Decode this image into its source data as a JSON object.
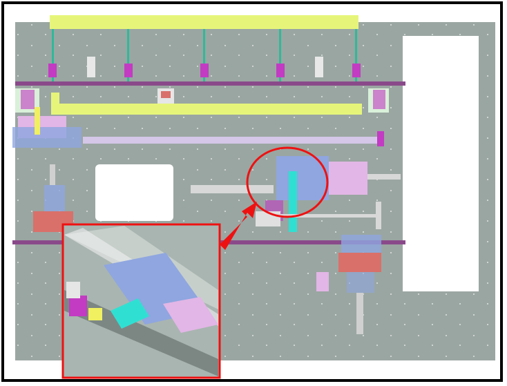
{
  "figure": {
    "colors": {
      "frame": "#000000",
      "plate": "#9aa6a2",
      "rail_yellow": "#e6f57a",
      "magenta": "#c23bc2",
      "beam_purple": "#8a4a8a",
      "teal": "#2fb99a",
      "blue_block": "#8fa6e0",
      "pink_block": "#e2b6e6",
      "red_block": "#d9706a",
      "cyan_part": "#2fe0d2",
      "callout_red": "#ee1111",
      "white_panel": "#ffffff"
    },
    "callout": {
      "shape": "ellipse",
      "pointer": "arrow",
      "inset": "zoomed-detail"
    }
  }
}
